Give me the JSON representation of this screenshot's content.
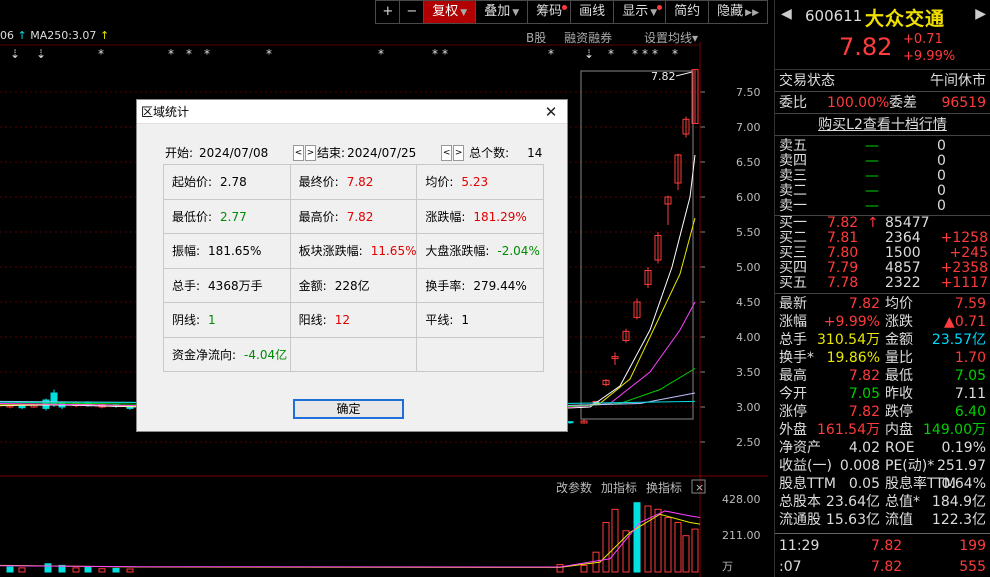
{
  "toolbar": {
    "plus": "+",
    "minus": "−",
    "fuquan": "复权",
    "diejia": "叠加",
    "chouma": "筹码",
    "huaxian": "画线",
    "xianshi": "显示",
    "jianyue": "简约",
    "yincang": "隐藏"
  },
  "ma_header": {
    "prefix": "06",
    "ma250": "MA250:3.07"
  },
  "chart_links": {
    "bgu": "B股",
    "rzrq": "融资融券",
    "setma": "设置均线"
  },
  "chart_peak_label": "7.82",
  "price_axis": [
    "7.50",
    "7.00",
    "6.50",
    "6.00",
    "5.50",
    "5.00",
    "4.50",
    "4.00",
    "3.50",
    "3.00",
    "2.50"
  ],
  "volume_axis": [
    "428.00",
    "211.00",
    "万"
  ],
  "volume_toolbar": {
    "gai": "改参数",
    "jia": "加指标",
    "huan": "换指标",
    "close": "×"
  },
  "dialog": {
    "title": "区域统计",
    "start_label": "开始:",
    "start_date": "2024/07/08",
    "end_label": "结束:",
    "end_date": "2024/07/25",
    "count_label": "总个数:",
    "count_value": "14",
    "rows": [
      [
        {
          "label": "起始价:",
          "value": "2.78",
          "color": "black"
        },
        {
          "label": "最终价:",
          "value": "7.82",
          "color": "red"
        },
        {
          "label": "均价:",
          "value": "5.23",
          "color": "red"
        }
      ],
      [
        {
          "label": "最低价:",
          "value": "2.77",
          "color": "green"
        },
        {
          "label": "最高价:",
          "value": "7.82",
          "color": "red"
        },
        {
          "label": "涨跌幅:",
          "value": "181.29%",
          "color": "red"
        }
      ],
      [
        {
          "label": "振幅:",
          "value": "181.65%",
          "color": "black"
        },
        {
          "label": "板块涨跌幅:",
          "value": "11.65%",
          "color": "red"
        },
        {
          "label": "大盘涨跌幅:",
          "value": "-2.04%",
          "color": "green"
        }
      ],
      [
        {
          "label": "总手:",
          "value": "4368万手",
          "color": "black"
        },
        {
          "label": "金额:",
          "value": "228亿",
          "color": "black"
        },
        {
          "label": "换手率:",
          "value": "279.44%",
          "color": "black"
        }
      ],
      [
        {
          "label": "阴线:",
          "value": "1",
          "color": "green"
        },
        {
          "label": "阳线:",
          "value": "12",
          "color": "red"
        },
        {
          "label": "平线:",
          "value": "1",
          "color": "black"
        }
      ],
      [
        {
          "label": "资金净流向:",
          "value": "-4.04亿",
          "color": "green"
        },
        {
          "label": "",
          "value": "",
          "color": "black"
        },
        {
          "label": "",
          "value": "",
          "color": "black"
        }
      ]
    ],
    "ok": "确定"
  },
  "quote": {
    "code": "600611",
    "name": "大众交通",
    "price": "7.82",
    "change": "+0.71",
    "change_pct": "+9.99%",
    "status_label": "交易状态",
    "status_value": "午间休市",
    "weibi_label": "委比",
    "weibi_value": "100.00%",
    "weicha_label": "委差",
    "weicha_value": "96519",
    "l2_link": "购买L2查看十档行情",
    "asks": [
      {
        "label": "卖五",
        "price": "—",
        "vol": "0"
      },
      {
        "label": "卖四",
        "price": "—",
        "vol": "0"
      },
      {
        "label": "卖三",
        "price": "—",
        "vol": "0"
      },
      {
        "label": "卖二",
        "price": "—",
        "vol": "0"
      },
      {
        "label": "卖一",
        "price": "—",
        "vol": "0"
      }
    ],
    "bids": [
      {
        "label": "买一",
        "price": "7.82",
        "vol": "85477",
        "delta": ""
      },
      {
        "label": "买二",
        "price": "7.81",
        "vol": "2364",
        "delta": "+1258"
      },
      {
        "label": "买三",
        "price": "7.80",
        "vol": "1500",
        "delta": "+245"
      },
      {
        "label": "买四",
        "price": "7.79",
        "vol": "4857",
        "delta": "+2358"
      },
      {
        "label": "买五",
        "price": "7.78",
        "vol": "2322",
        "delta": "+1117"
      }
    ],
    "stats": [
      {
        "l1": "最新",
        "v1": "7.82",
        "c1": "r",
        "l2": "均价",
        "v2": "7.59",
        "c2": "r"
      },
      {
        "l1": "涨幅",
        "v1": "+9.99%",
        "c1": "r",
        "l2": "涨跌",
        "v2": "▲0.71",
        "c2": "r"
      },
      {
        "l1": "总手",
        "v1": "310.54万",
        "c1": "y",
        "l2": "金额",
        "v2": "23.57亿",
        "c2": "c"
      },
      {
        "l1": "换手*",
        "v1": "19.86%",
        "c1": "y",
        "l2": "量比",
        "v2": "1.70",
        "c2": "r"
      },
      {
        "l1": "最高",
        "v1": "7.82",
        "c1": "r",
        "l2": "最低",
        "v2": "7.05",
        "c2": "g"
      },
      {
        "l1": "今开",
        "v1": "7.05",
        "c1": "g",
        "l2": "昨收",
        "v2": "7.11",
        "c2": "w"
      },
      {
        "l1": "涨停",
        "v1": "7.82",
        "c1": "r",
        "l2": "跌停",
        "v2": "6.40",
        "c2": "g"
      },
      {
        "l1": "外盘",
        "v1": "161.54万",
        "c1": "r",
        "l2": "内盘",
        "v2": "149.00万",
        "c2": "g"
      },
      {
        "l1": "净资产",
        "v1": "4.02",
        "c1": "w",
        "l2": "ROE",
        "v2": "0.19%",
        "c2": "w"
      },
      {
        "l1": "收益(一)",
        "v1": "0.008",
        "c1": "w",
        "l2": "PE(动)*",
        "v2": "251.97",
        "c2": "w"
      },
      {
        "l1": "股息TTM",
        "v1": "0.05",
        "c1": "w",
        "l2": "股息率TTM",
        "v2": "0.64%",
        "c2": "w"
      },
      {
        "l1": "总股本",
        "v1": "23.64亿",
        "c1": "w",
        "l2": "总值*",
        "v2": "184.9亿",
        "c2": "w"
      },
      {
        "l1": "流通股",
        "v1": "15.63亿",
        "c1": "w",
        "l2": "流值",
        "v2": "122.3亿",
        "c2": "w"
      }
    ],
    "ticks": [
      {
        "time": "11:29",
        "price": "7.82",
        "vol": "199"
      },
      {
        "time": ":07",
        "price": "7.82",
        "vol": "555"
      }
    ]
  },
  "colors": {
    "up": "#ff3b3b",
    "down": "#00d000",
    "cyan": "#00d8ff",
    "yellow": "#e8e800",
    "toolbar_active": "#b00000"
  }
}
